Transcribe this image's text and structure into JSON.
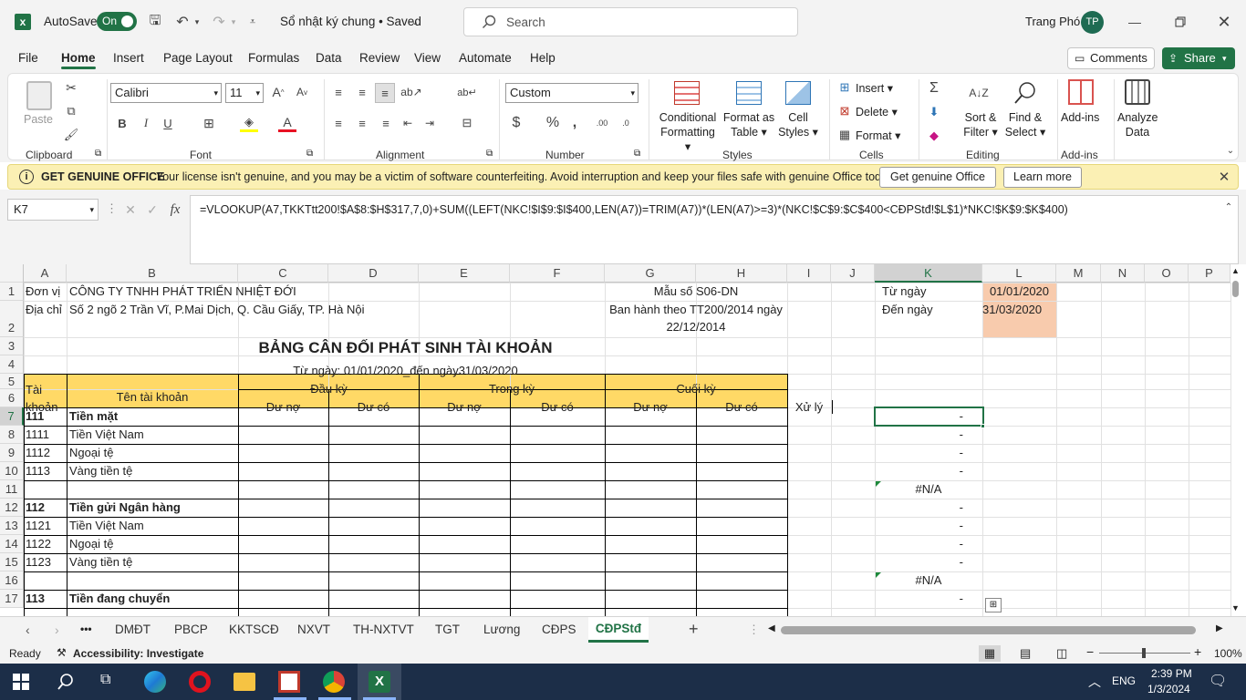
{
  "titlebar": {
    "app_icon": "excel-icon",
    "autosave_label": "AutoSave",
    "autosave_state": "On",
    "document_title": "Sổ nhật ký chung • Saved",
    "search_placeholder": "Search",
    "user_name": "Trang Phó",
    "user_initials": "TP"
  },
  "menu": [
    "File",
    "Home",
    "Insert",
    "Page Layout",
    "Formulas",
    "Data",
    "Review",
    "View",
    "Automate",
    "Help"
  ],
  "menu_active": "Home",
  "menu_right": {
    "comments": "Comments",
    "share": "Share"
  },
  "ribbon": {
    "clipboard": {
      "paste": "Paste",
      "label": "Clipboard"
    },
    "font": {
      "name": "Calibri",
      "size": "11",
      "label": "Font"
    },
    "alignment": {
      "label": "Alignment"
    },
    "number": {
      "format": "Custom",
      "label": "Number"
    },
    "styles": {
      "conditional": "Conditional",
      "formatting": "Formatting",
      "format_as": "Format as",
      "table": "Table",
      "cell": "Cell",
      "styles": "Styles",
      "label": "Styles"
    },
    "cells": {
      "insert": "Insert",
      "delete": "Delete",
      "format": "Format",
      "label": "Cells"
    },
    "editing": {
      "sort": "Sort &",
      "filter": "Filter",
      "find": "Find &",
      "select": "Select",
      "label": "Editing"
    },
    "addins": {
      "addins": "Add-ins",
      "label": "Add-ins"
    },
    "analyze": {
      "analyze": "Analyze",
      "data": "Data"
    }
  },
  "notice": {
    "title": "GET GENUINE OFFICE",
    "message": "Your license isn't genuine, and you may be a victim of software counterfeiting. Avoid interruption and keep your files safe with genuine Office today.",
    "btn_genuine": "Get genuine Office",
    "btn_learn": "Learn more"
  },
  "formula_bar": {
    "name_box": "K7",
    "fx": "fx",
    "formula": "=VLOOKUP(A7,TKKTtt200!$A$8:$H$317,7,0)+SUM((LEFT(NKC!$I$9:$I$400,LEN(A7))=TRIM(A7))*(LEN(A7)>=3)*(NKC!$C$9:$C$400<CĐPStđ!$L$1)*NKC!$K$9:$K$400)"
  },
  "columns": [
    "A",
    "B",
    "C",
    "D",
    "E",
    "F",
    "G",
    "H",
    "I",
    "J",
    "K",
    "L",
    "M",
    "N",
    "O",
    "P"
  ],
  "rows": [
    "1",
    "2",
    "3",
    "4",
    "5",
    "6",
    "7",
    "8",
    "9",
    "10",
    "11",
    "12",
    "13",
    "14",
    "15",
    "16",
    "17"
  ],
  "cells": {
    "a1": "Đơn vị",
    "b1": "CÔNG TY TNHH PHÁT TRIỂN NHIỆT ĐỚI",
    "g1": "Mẫu số S06-DN",
    "k1": "Từ ngày",
    "l1": "01/01/2020",
    "a2": "Địa chỉ",
    "b2": "Số 2 ngõ 2 Trần Vĩ, P.Mai Dịch, Q. Cầu Giấy, TP. Hà Nội",
    "g2a": "Ban hành theo TT200/2014 ngày",
    "g2b": "22/12/2014",
    "k2": "Đến ngày",
    "l2": "31/03/2020",
    "title": "BẢNG CÂN ĐỐI PHÁT SINH TÀI KHOẢN",
    "subtitle": "Từ ngày:  01/01/2020_đến ngày31/03/2020",
    "h_tai": "Tài",
    "h_khoan": "khoản",
    "h_ten": "Tên tài khoản",
    "h_dauky": "Đầu kỳ",
    "h_trongky": "Trong kỳ",
    "h_cuoiky": "Cuối kỳ",
    "h_duno": "Dư nợ",
    "h_duco": "Dư có",
    "i6": "Xử lý"
  },
  "table_rows": [
    {
      "acc": "111",
      "name": "Tiền mặt",
      "bold": true,
      "k": "-"
    },
    {
      "acc": "1111",
      "name": "Tiền Việt Nam",
      "bold": false,
      "k": "-"
    },
    {
      "acc": "1112",
      "name": "Ngoại tệ",
      "bold": false,
      "k": "-"
    },
    {
      "acc": "1113",
      "name": "Vàng tiền tệ",
      "bold": false,
      "k": "-"
    },
    {
      "acc": "",
      "name": "",
      "bold": false,
      "k": "#N/A"
    },
    {
      "acc": "112",
      "name": "Tiền gửi Ngân hàng",
      "bold": true,
      "k": "-"
    },
    {
      "acc": "1121",
      "name": "Tiền Việt Nam",
      "bold": false,
      "k": "-"
    },
    {
      "acc": "1122",
      "name": "Ngoại tệ",
      "bold": false,
      "k": "-"
    },
    {
      "acc": "1123",
      "name": "Vàng tiền tệ",
      "bold": false,
      "k": "-"
    },
    {
      "acc": "",
      "name": "",
      "bold": false,
      "k": "#N/A"
    },
    {
      "acc": "113",
      "name": "Tiền đang chuyển",
      "bold": true,
      "k": "-"
    }
  ],
  "sheet_tabs": [
    "DMĐT",
    "PBCP",
    "KKTSCĐ",
    "NXVT",
    "TH-NXTVT",
    "TGT",
    "Lương",
    "CĐPS",
    "CĐPStđ"
  ],
  "sheet_active": "CĐPStđ",
  "status": {
    "ready": "Ready",
    "accessibility": "Accessibility: Investigate",
    "zoom": "100%"
  },
  "taskbar": {
    "lang": "ENG",
    "time": "2:39 PM",
    "date": "1/3/2024"
  },
  "colors": {
    "excel_green": "#217346",
    "header_yellow": "#ffd966",
    "date_orange": "#f8cbad",
    "notice_bg": "#fbf0b4"
  }
}
